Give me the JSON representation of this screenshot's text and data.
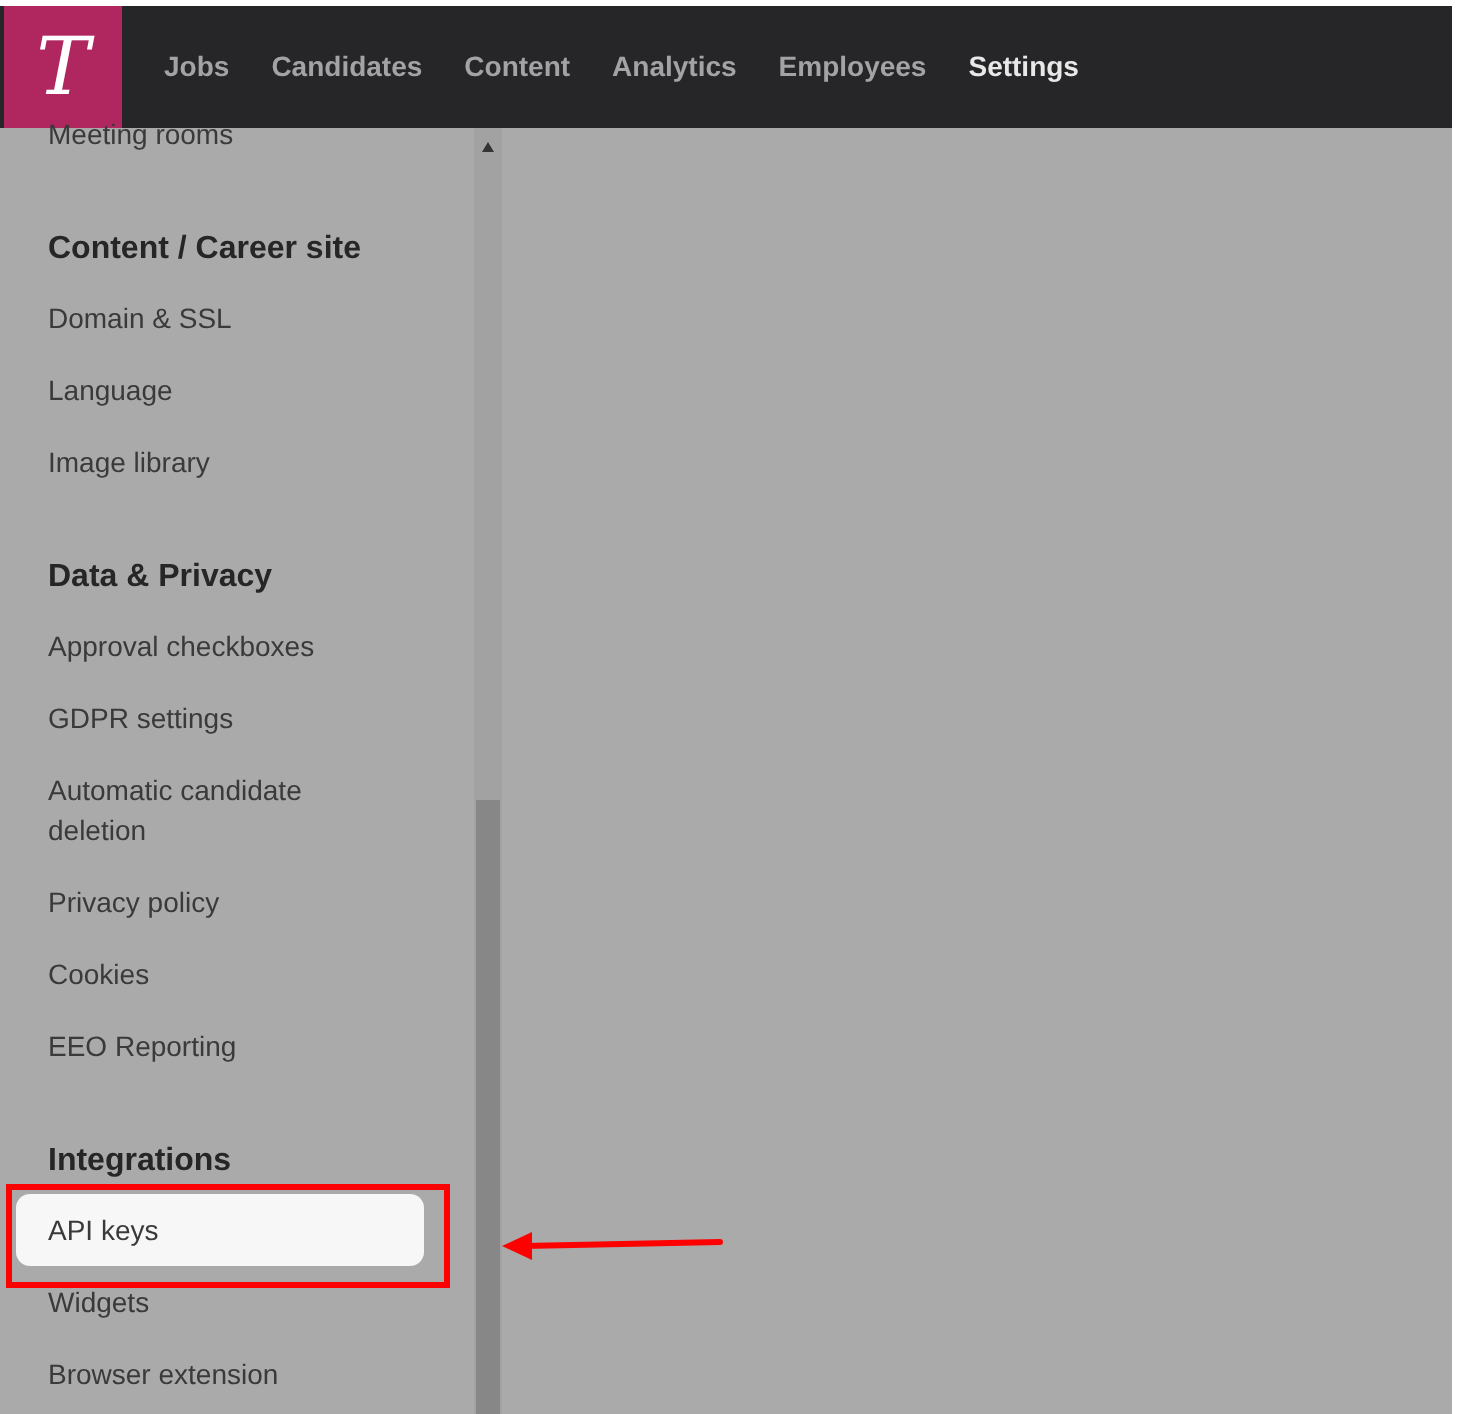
{
  "logo": {
    "letter": "T"
  },
  "nav": [
    {
      "label": "Jobs",
      "selected": false
    },
    {
      "label": "Candidates",
      "selected": false
    },
    {
      "label": "Content",
      "selected": false
    },
    {
      "label": "Analytics",
      "selected": false
    },
    {
      "label": "Employees",
      "selected": false
    },
    {
      "label": "Settings",
      "selected": true
    }
  ],
  "sidebar": {
    "items": [
      {
        "label": "Meeting rooms",
        "selected": false
      }
    ],
    "sections": [
      {
        "title": "Content / Career site",
        "items": [
          {
            "label": "Domain & SSL",
            "selected": false
          },
          {
            "label": "Language",
            "selected": false
          },
          {
            "label": "Image library",
            "selected": false
          }
        ]
      },
      {
        "title": "Data & Privacy",
        "items": [
          {
            "label": "Approval checkboxes",
            "selected": false
          },
          {
            "label": "GDPR settings",
            "selected": false
          },
          {
            "label": "Automatic candidate deletion",
            "selected": false
          },
          {
            "label": "Privacy policy",
            "selected": false
          },
          {
            "label": "Cookies",
            "selected": false
          },
          {
            "label": "EEO Reporting",
            "selected": false
          }
        ]
      },
      {
        "title": "Integrations",
        "items": [
          {
            "label": "API keys",
            "selected": true
          },
          {
            "label": "Widgets",
            "selected": false
          },
          {
            "label": "Browser extension",
            "selected": false
          }
        ]
      }
    ]
  }
}
